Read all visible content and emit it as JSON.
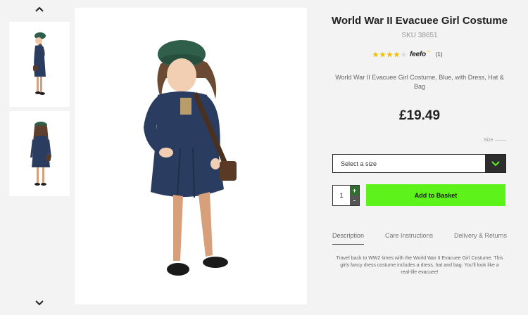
{
  "gallery": {
    "up_icon": "chevron-up-icon",
    "down_icon": "chevron-down-icon",
    "thumbnails": [
      "side view",
      "back view"
    ]
  },
  "product": {
    "title": "World War II Evacuee Girl Costume",
    "sku": "SKU 38651",
    "rating": {
      "stars": 4,
      "max": 5,
      "provider": "feefo",
      "provider_mark": "™",
      "count": "(1)"
    },
    "description": "World War II Evacuee Girl Costume, Blue, with Dress, Hat & Bag",
    "price": "£19.49",
    "size_label": "Size",
    "size_select": {
      "placeholder": "Select a size"
    },
    "quantity": {
      "value": "1",
      "plus": "+",
      "minus": "-"
    },
    "add_to_basket": "Add to Basket"
  },
  "tabs": [
    {
      "label": "Description",
      "active": true
    },
    {
      "label": "Care Instructions",
      "active": false
    },
    {
      "label": "Delivery & Returns",
      "active": false
    }
  ],
  "tab_content": "Travel back to WW2 times with the World War II Evacuee Girl Costume. This girls fancy dress costume includes a dress, hat and bag. You'll look like a real-life evacuee!",
  "colors": {
    "basket": "#5cf21a",
    "select_button": "#2d2d2d",
    "star": "#f2c200",
    "dress": "#2a3c5f",
    "beret": "#2f5e4a"
  }
}
